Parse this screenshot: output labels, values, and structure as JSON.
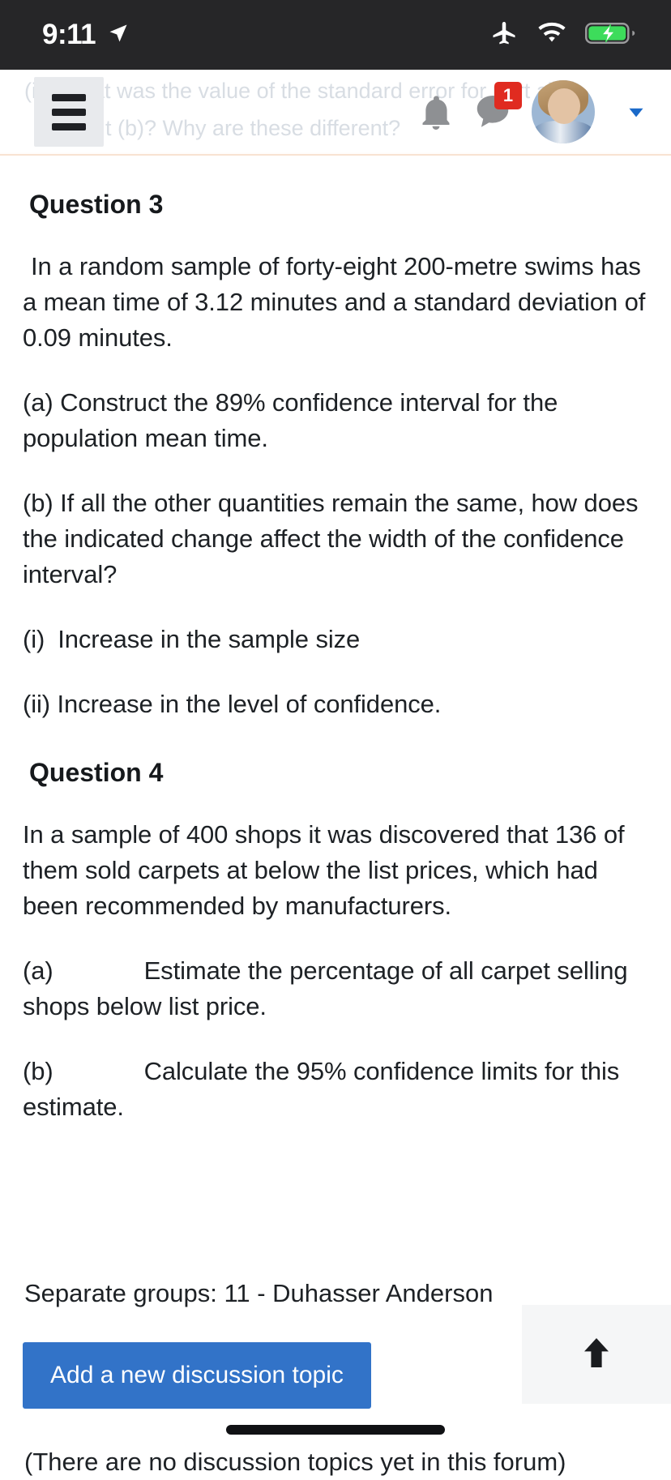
{
  "status_bar": {
    "time": "9:11",
    "location_icon": "location-arrow-icon",
    "airplane_icon": "airplane-mode-icon",
    "wifi_icon": "wifi-icon",
    "battery_icon": "battery-charging-icon",
    "battery_color": "#3ddc5b",
    "background": "#262628"
  },
  "header": {
    "menu_icon": "hamburger-menu-icon",
    "bell_icon": "notifications-bell-icon",
    "messages_icon": "messages-bubble-icon",
    "messages_badge": "1",
    "badge_color": "#e02b20",
    "avatar_icon": "user-avatar",
    "chevron_icon": "chevron-down-icon",
    "chevron_color": "#1b6ac9",
    "ghost_line_1": "(iii) What was the value of the standard error for part a)?",
    "ghost_line_2": "t (b)? Why are these different?",
    "rule_color": "#f8e3d2"
  },
  "content": {
    "question3": {
      "title": "Question 3",
      "intro": "In a random sample of forty-eight 200-metre swims has a mean time of 3.12 minutes and a standard deviation of 0.09 minutes.",
      "part_a": "(a) Construct the 89% confidence interval for the population mean time.",
      "part_b": "(b) If all the other quantities remain the same, how does the indicated change affect the width of the confidence interval?",
      "sub_i": "(i)",
      "sub_i_text": "Increase in the sample size",
      "sub_ii": "(ii) Increase in the level of confidence."
    },
    "question4": {
      "title": "Question 4",
      "intro": "In a sample of 400 shops it was discovered that 136 of them sold carpets at below the list prices, which had been recommended by manufacturers.",
      "part_a_label": "(a)",
      "part_a_text": "Estimate the percentage of all carpet selling shops below list price.",
      "part_b_label": "(b)",
      "part_b_text": "Calculate the 95% confidence limits for this estimate."
    },
    "separate_groups": "Separate groups: 11 - Duhasser Anderson",
    "add_topic_button": "Add a new discussion topic",
    "add_topic_color": "#3273c8",
    "no_topics_message": "(There are no discussion topics yet in this forum)"
  },
  "footer": {
    "scroll_top_icon": "arrow-up-icon",
    "home_indicator": "home-indicator"
  }
}
